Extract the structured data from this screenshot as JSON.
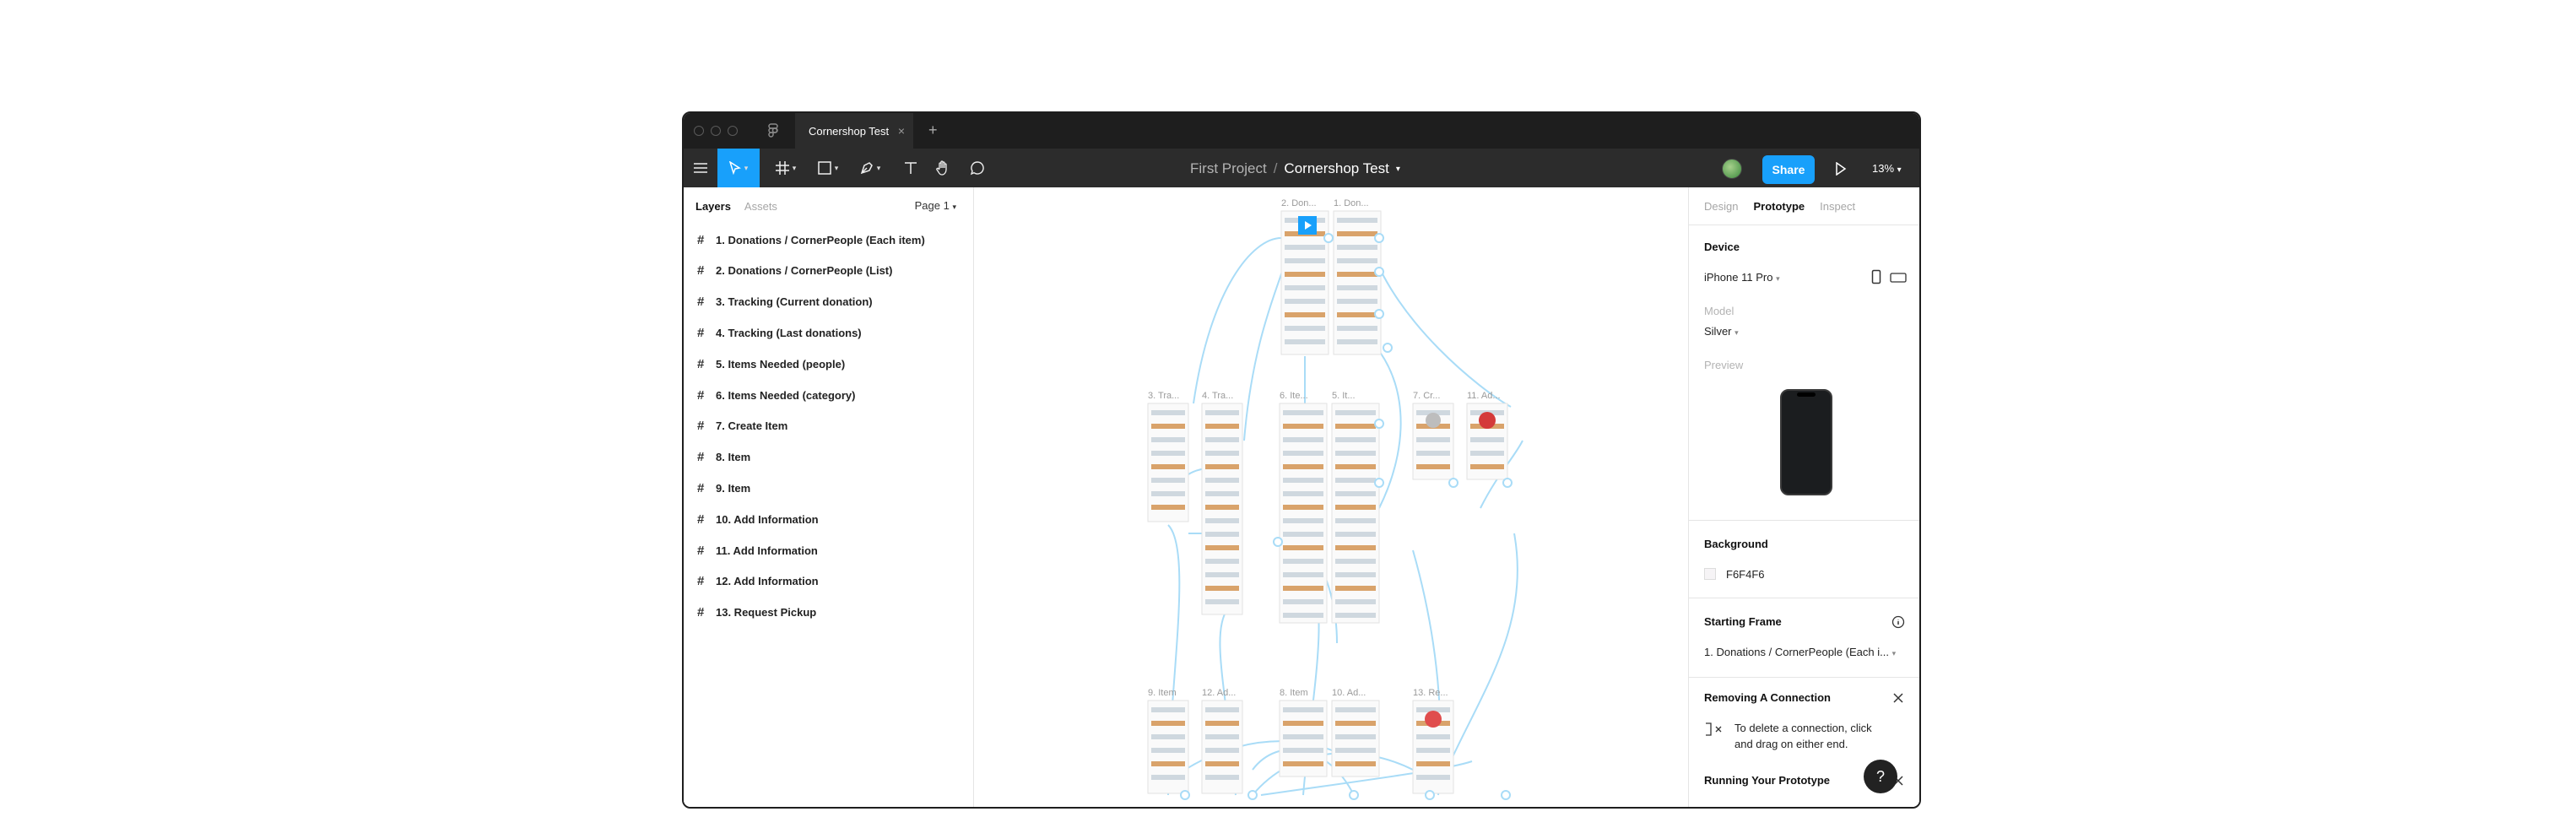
{
  "titlebar": {
    "tab_label": "Cornershop Test",
    "tab_close": "×",
    "new_tab": "+"
  },
  "toolbar": {
    "menu_icon": "hamburger-icon",
    "tools": [
      "move-tool",
      "frame-tool",
      "shape-tool",
      "pen-tool",
      "text-tool",
      "hand-tool",
      "comment-tool"
    ],
    "breadcrumb_project": "First Project",
    "breadcrumb_separator": "/",
    "breadcrumb_file": "Cornershop Test",
    "share_label": "Share",
    "zoom_label": "13%"
  },
  "layers_panel": {
    "tab_layers": "Layers",
    "tab_assets": "Assets",
    "page_label": "Page 1",
    "items": [
      "1. Donations / CornerPeople (Each item)",
      "2. Donations / CornerPeople (List)",
      "3. Tracking (Current donation)",
      "4. Tracking (Last donations)",
      "5. Items Needed (people)",
      "6. Items Needed (category)",
      "7. Create Item",
      "8. Item",
      "9. Item",
      "10. Add Information",
      "11. Add Information",
      "12. Add Information",
      "13. Request Pickup"
    ]
  },
  "canvas": {
    "frame_labels": [
      "2. Don...",
      "1. Don...",
      "3. Tra...",
      "4. Tra...",
      "6. Ite...",
      "5. It...",
      "7. Cr...",
      "11. Ad...",
      "9. Item",
      "12. Ad...",
      "8. Item",
      "10. Ad...",
      "13. Re..."
    ]
  },
  "right_panel": {
    "tab_design": "Design",
    "tab_prototype": "Prototype",
    "tab_inspect": "Inspect",
    "device_heading": "Device",
    "device_value": "iPhone 11 Pro",
    "model_label": "Model",
    "model_value": "Silver",
    "preview_label": "Preview",
    "background_heading": "Background",
    "background_value": "F6F4F6",
    "starting_frame_heading": "Starting Frame",
    "starting_frame_value": "1. Donations / CornerPeople (Each i...",
    "removing_heading": "Removing A Connection",
    "removing_text_1": "To delete a connection, click",
    "removing_text_2": "and drag on either end.",
    "running_heading": "Running Your Prototype",
    "help_label": "?"
  },
  "colors": {
    "accent": "#18a0fb",
    "toolbar_bg": "#2c2c2c",
    "titlebar_bg": "#1e1e1e",
    "connector": "#a9dcf7"
  }
}
